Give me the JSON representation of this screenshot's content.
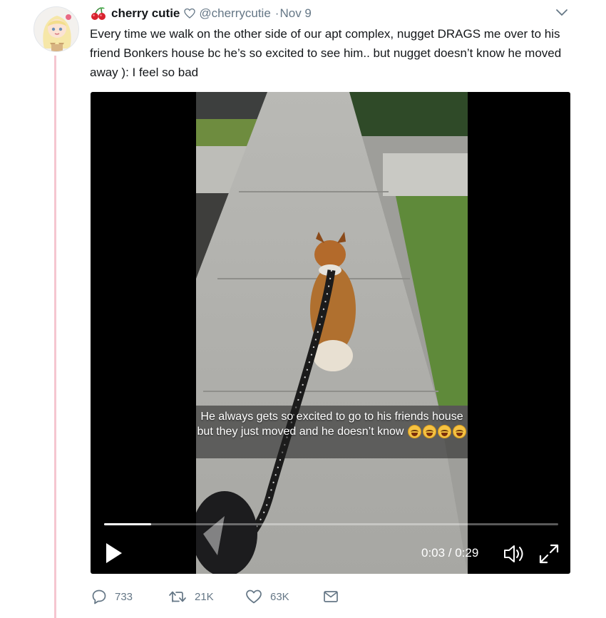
{
  "tweet": {
    "display_name": "cherry cutie",
    "handle": "@cherrycutie",
    "separator": "·",
    "date": "Nov 9",
    "text": "Every time we walk on the other side of our apt complex, nugget DRAGS me over to his friend Bonkers house bc he’s so excited to see him.. but nugget doesn’t know he moved away ): I feel so bad",
    "name_emoji": "cherries-icon",
    "name_suffix_icon": "heart-outline-icon"
  },
  "video": {
    "caption": "He always gets so excited to go to his friends house but they just moved and he doesn’t know",
    "caption_emoji": "loudly-crying-face-icon",
    "caption_emoji_count": 4,
    "time": "0:03 / 0:29",
    "progress": 0.103
  },
  "actions": {
    "replies": "733",
    "retweets": "21K",
    "likes": "63K"
  },
  "colors": {
    "thread_line": "#f5c6d0",
    "text": "#14171a",
    "secondary": "#657786",
    "video_bg": "#000000"
  }
}
